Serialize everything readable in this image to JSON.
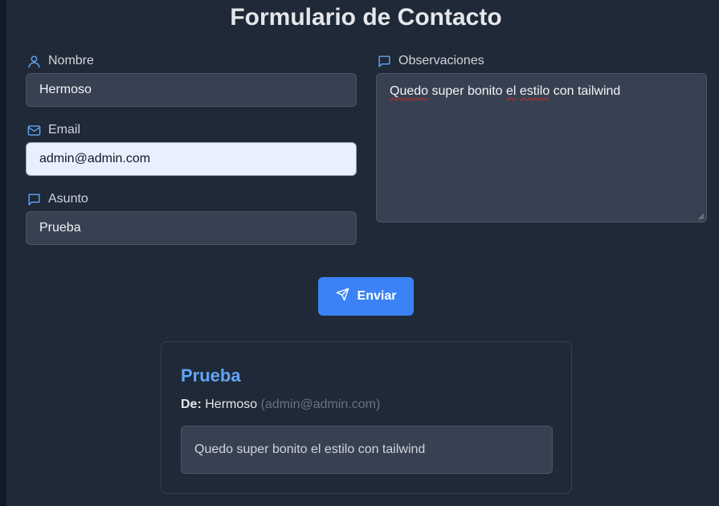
{
  "form": {
    "title": "Formulario de Contacto",
    "nombre": {
      "label": "Nombre",
      "value": "Hermoso",
      "icon": "user-icon"
    },
    "email": {
      "label": "Email",
      "value": "admin@admin.com",
      "icon": "mail-icon"
    },
    "asunto": {
      "label": "Asunto",
      "value": "Prueba",
      "icon": "chat-icon"
    },
    "observaciones": {
      "label": "Observaciones",
      "icon": "chat-icon",
      "value_parts": [
        "Quedo",
        " super bonito ",
        "el",
        " ",
        "estilo",
        " con tailwind"
      ]
    },
    "submit_label": "Enviar",
    "submit_icon": "send-icon"
  },
  "message": {
    "subject": "Prueba",
    "from_label": "De:",
    "from_name": "Hermoso",
    "from_email": "(admin@admin.com)",
    "body": "Quedo super bonito el estilo con tailwind"
  },
  "colors": {
    "background": "#1f2937",
    "accent": "#3b82f6",
    "subject": "#60a5fa",
    "input_bg": "#374151"
  }
}
